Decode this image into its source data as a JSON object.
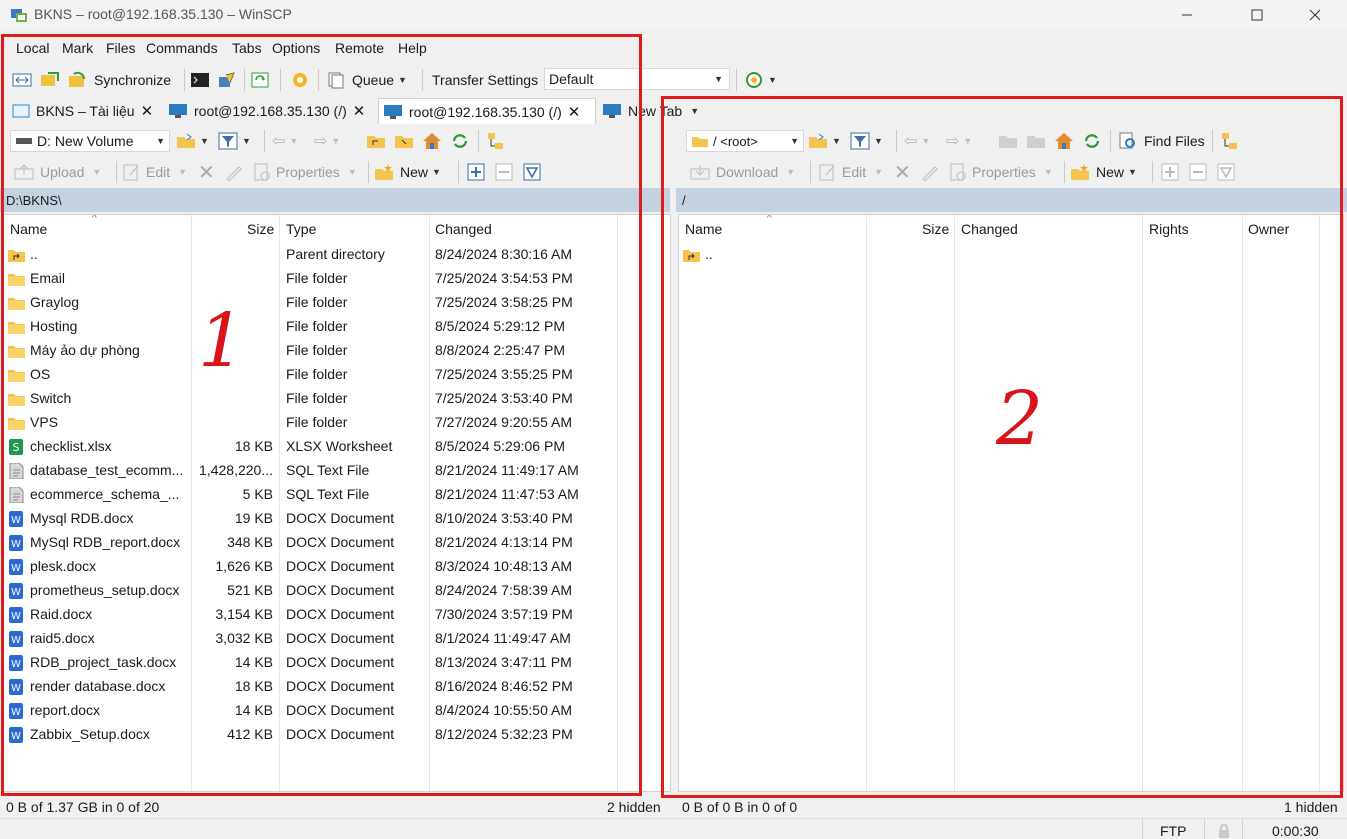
{
  "window": {
    "title": "BKNS – root@192.168.35.130 – WinSCP"
  },
  "menu": [
    "Local",
    "Mark",
    "Files",
    "Commands",
    "Tabs",
    "Options",
    "Remote",
    "Help"
  ],
  "toolbar": {
    "synchronize": "Synchronize",
    "queue": "Queue",
    "transfer_settings": "Transfer Settings",
    "transfer_value": "Default"
  },
  "tabs": [
    {
      "label": "BKNS – Tài liệu"
    },
    {
      "label": "root@192.168.35.130 (/)"
    },
    {
      "label": "root@192.168.35.130 (/)"
    },
    {
      "label": "New Tab"
    }
  ],
  "left": {
    "drive": "D: New Volume",
    "upload": "Upload",
    "edit": "Edit",
    "properties": "Properties",
    "new": "New",
    "path": "D:\\BKNS\\",
    "columns": [
      "Name",
      "Size",
      "Type",
      "Changed"
    ],
    "files": [
      {
        "name": "..",
        "size": "",
        "type": "Parent directory",
        "changed": "8/24/2024 8:30:16 AM",
        "icon": "parent-folder"
      },
      {
        "name": "Email",
        "size": "",
        "type": "File folder",
        "changed": "7/25/2024 3:54:53 PM",
        "icon": "folder"
      },
      {
        "name": "Graylog",
        "size": "",
        "type": "File folder",
        "changed": "7/25/2024 3:58:25 PM",
        "icon": "folder"
      },
      {
        "name": "Hosting",
        "size": "",
        "type": "File folder",
        "changed": "8/5/2024 5:29:12 PM",
        "icon": "folder"
      },
      {
        "name": "Máy ảo dự phòng",
        "size": "",
        "type": "File folder",
        "changed": "8/8/2024 2:25:47 PM",
        "icon": "folder"
      },
      {
        "name": "OS",
        "size": "",
        "type": "File folder",
        "changed": "7/25/2024 3:55:25 PM",
        "icon": "folder"
      },
      {
        "name": "Switch",
        "size": "",
        "type": "File folder",
        "changed": "7/25/2024 3:53:40 PM",
        "icon": "folder"
      },
      {
        "name": "VPS",
        "size": "",
        "type": "File folder",
        "changed": "7/27/2024 9:20:55 AM",
        "icon": "folder"
      },
      {
        "name": "checklist.xlsx",
        "size": "18 KB",
        "type": "XLSX Worksheet",
        "changed": "8/5/2024 5:29:06 PM",
        "icon": "xlsx"
      },
      {
        "name": "database_test_ecomm...",
        "size": "1,428,220...",
        "type": "SQL Text File",
        "changed": "8/21/2024 11:49:17 AM",
        "icon": "sql"
      },
      {
        "name": "ecommerce_schema_...",
        "size": "5 KB",
        "type": "SQL Text File",
        "changed": "8/21/2024 11:47:53 AM",
        "icon": "sql"
      },
      {
        "name": "Mysql RDB.docx",
        "size": "19 KB",
        "type": "DOCX Document",
        "changed": "8/10/2024 3:53:40 PM",
        "icon": "docx"
      },
      {
        "name": "MySql RDB_report.docx",
        "size": "348 KB",
        "type": "DOCX Document",
        "changed": "8/21/2024 4:13:14 PM",
        "icon": "docx"
      },
      {
        "name": "plesk.docx",
        "size": "1,626 KB",
        "type": "DOCX Document",
        "changed": "8/3/2024 10:48:13 AM",
        "icon": "docx"
      },
      {
        "name": "prometheus_setup.docx",
        "size": "521 KB",
        "type": "DOCX Document",
        "changed": "8/24/2024 7:58:39 AM",
        "icon": "docx"
      },
      {
        "name": "Raid.docx",
        "size": "3,154 KB",
        "type": "DOCX Document",
        "changed": "7/30/2024 3:57:19 PM",
        "icon": "docx"
      },
      {
        "name": "raid5.docx",
        "size": "3,032 KB",
        "type": "DOCX Document",
        "changed": "8/1/2024 11:49:47 AM",
        "icon": "docx"
      },
      {
        "name": "RDB_project_task.docx",
        "size": "14 KB",
        "type": "DOCX Document",
        "changed": "8/13/2024 3:47:11 PM",
        "icon": "docx"
      },
      {
        "name": "render database.docx",
        "size": "18 KB",
        "type": "DOCX Document",
        "changed": "8/16/2024 8:46:52 PM",
        "icon": "docx"
      },
      {
        "name": "report.docx",
        "size": "14 KB",
        "type": "DOCX Document",
        "changed": "8/4/2024 10:55:50 AM",
        "icon": "docx"
      },
      {
        "name": "Zabbix_Setup.docx",
        "size": "412 KB",
        "type": "DOCX Document",
        "changed": "8/12/2024 5:32:23 PM",
        "icon": "docx"
      }
    ],
    "status": "0 B of 1.37 GB in 0 of 20",
    "hidden": "2 hidden"
  },
  "right": {
    "dir": "/ <root>",
    "find_files": "Find Files",
    "download": "Download",
    "edit": "Edit",
    "properties": "Properties",
    "new": "New",
    "path": "/",
    "columns": [
      "Name",
      "Size",
      "Changed",
      "Rights",
      "Owner"
    ],
    "files": [
      {
        "name": "..",
        "icon": "parent-folder"
      }
    ],
    "status": "0 B of 0 B in 0 of 0",
    "hidden": "1 hidden"
  },
  "statusbar": {
    "protocol": "FTP",
    "time": "0:00:30"
  },
  "annotations": {
    "label1": "1",
    "label2": "2",
    "color": "#e01b1b"
  }
}
